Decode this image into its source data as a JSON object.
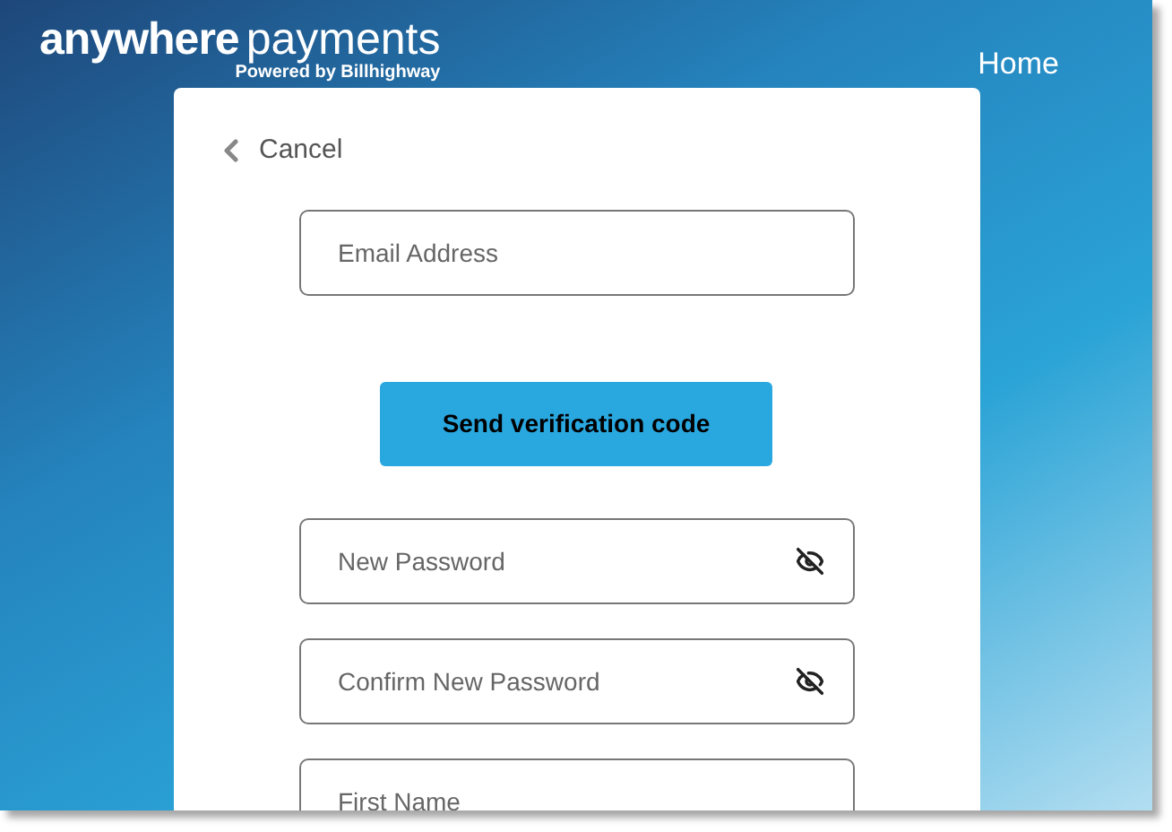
{
  "header": {
    "logo_bold": "anywhere",
    "logo_light": "payments",
    "tagline": "Powered by Billhighway",
    "nav": [
      "Home"
    ]
  },
  "form": {
    "cancel": "Cancel",
    "fields": [
      {
        "kind": "text",
        "placeholder": "Email Address"
      },
      {
        "kind": "button",
        "label": "Send verification code"
      },
      {
        "kind": "password",
        "placeholder": "New Password"
      },
      {
        "kind": "password",
        "placeholder": "Confirm New Password"
      },
      {
        "kind": "text",
        "placeholder": "First Name"
      }
    ]
  }
}
